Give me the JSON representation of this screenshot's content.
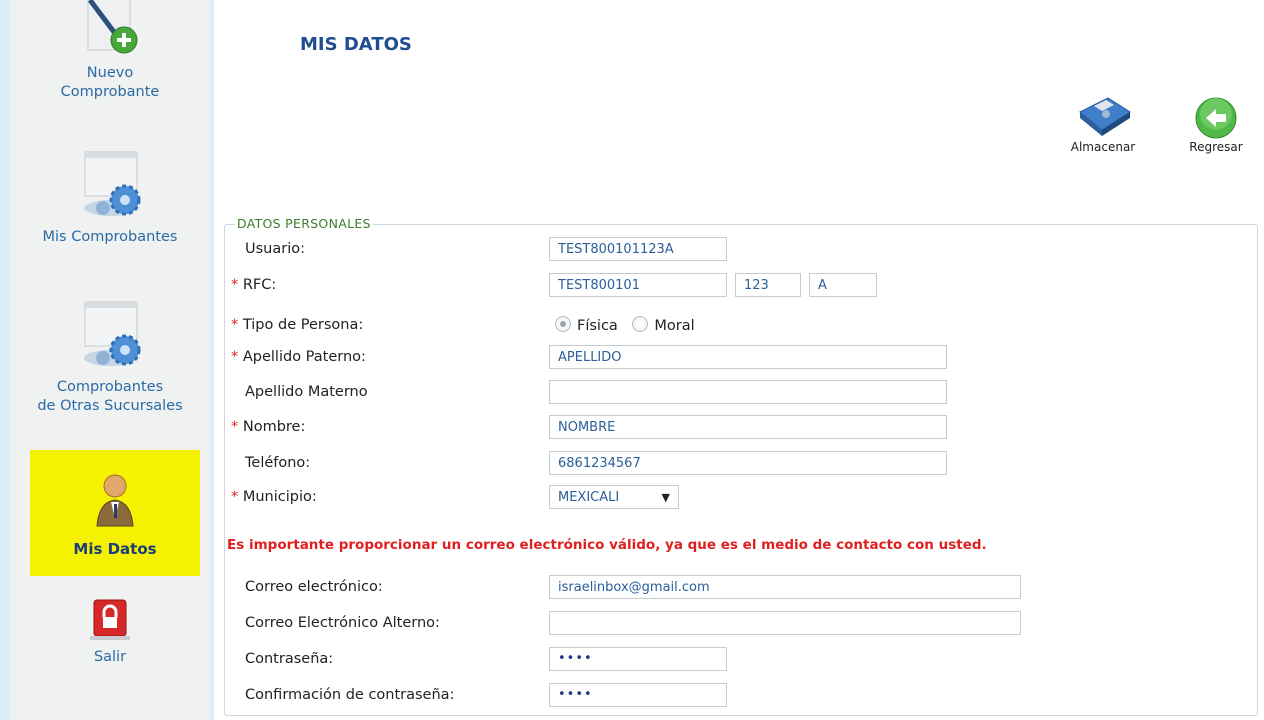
{
  "sidebar": {
    "nuevo": "Nuevo\nComprobante",
    "nuevo_l1": "Nuevo",
    "nuevo_l2": "Comprobante",
    "mis": "Mis Comprobantes",
    "otras_l1": "Comprobantes",
    "otras_l2": "de Otras Sucursales",
    "datos": "Mis Datos",
    "salir": "Salir"
  },
  "page": {
    "title": "MIS DATOS",
    "save_label": "Almacenar",
    "back_label": "Regresar"
  },
  "form": {
    "legend": "DATOS PERSONALES",
    "usuario_label": "Usuario:",
    "usuario": "TEST800101123A",
    "rfc_label": "RFC:",
    "rfc1": "TEST800101",
    "rfc2": "123",
    "rfc3": "A",
    "tipo_label": "Tipo de Persona:",
    "tipo_fisica": "Física",
    "tipo_moral": "Moral",
    "tipo_selected": "Física",
    "paterno_label": "Apellido Paterno:",
    "paterno": "APELLIDO",
    "materno_label": "Apellido Materno",
    "materno": "",
    "nombre_label": "Nombre:",
    "nombre": "NOMBRE",
    "telefono_label": "Teléfono:",
    "telefono": "6861234567",
    "municipio_label": "Municipio:",
    "municipio": "MEXICALI",
    "notice": "Es importante proporcionar un correo electrónico válido, ya que es el medio de contacto con usted.",
    "correo_label": "Correo electrónico:",
    "correo": "israelinbox@gmail.com",
    "alterno_label": "Correo Electrónico Alterno:",
    "alterno": "",
    "pass_label": "Contraseña:",
    "pass": "••••",
    "confirm_label": "Confirmación de contraseña:",
    "confirm": "••••",
    "required_mark": "*"
  },
  "colors": {
    "accent": "#1f4d8f",
    "required": "#e02020",
    "active_nav": "#f4f200",
    "link": "#2a6ba6"
  }
}
